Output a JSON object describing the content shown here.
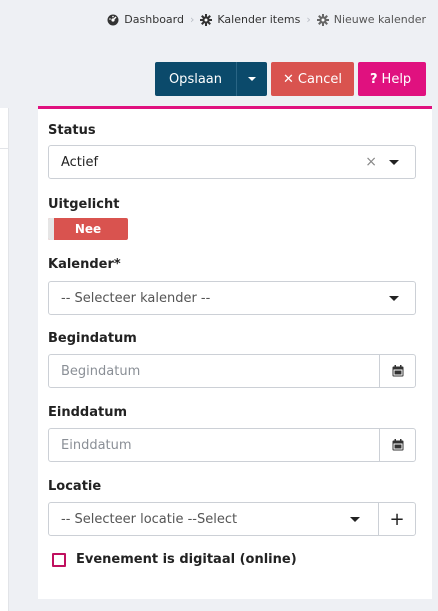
{
  "breadcrumb": {
    "items": [
      {
        "label": "Dashboard",
        "icon": "dashboard-icon"
      },
      {
        "label": "Kalender items",
        "icon": "gear-icon"
      },
      {
        "label": "Nieuwe kalender",
        "icon": "gear-icon"
      }
    ]
  },
  "toolbar": {
    "save_label": "Opslaan",
    "cancel_label": "Cancel",
    "help_label": "Help"
  },
  "colors": {
    "accent": "#e0117f",
    "primary": "#0b4a6b",
    "danger": "#d9534f"
  },
  "form": {
    "status": {
      "label": "Status",
      "value": "Actief"
    },
    "featured": {
      "label": "Uitgelicht",
      "toggle_text": "Nee"
    },
    "calendar": {
      "label": "Kalender*",
      "placeholder": "-- Selecteer kalender --"
    },
    "start_date": {
      "label": "Begindatum",
      "placeholder": "Begindatum"
    },
    "end_date": {
      "label": "Einddatum",
      "placeholder": "Einddatum"
    },
    "location": {
      "label": "Locatie",
      "placeholder": "-- Selecteer locatie --Select"
    },
    "digital": {
      "label": "Evenement is digitaal (online)",
      "checked": false
    }
  }
}
